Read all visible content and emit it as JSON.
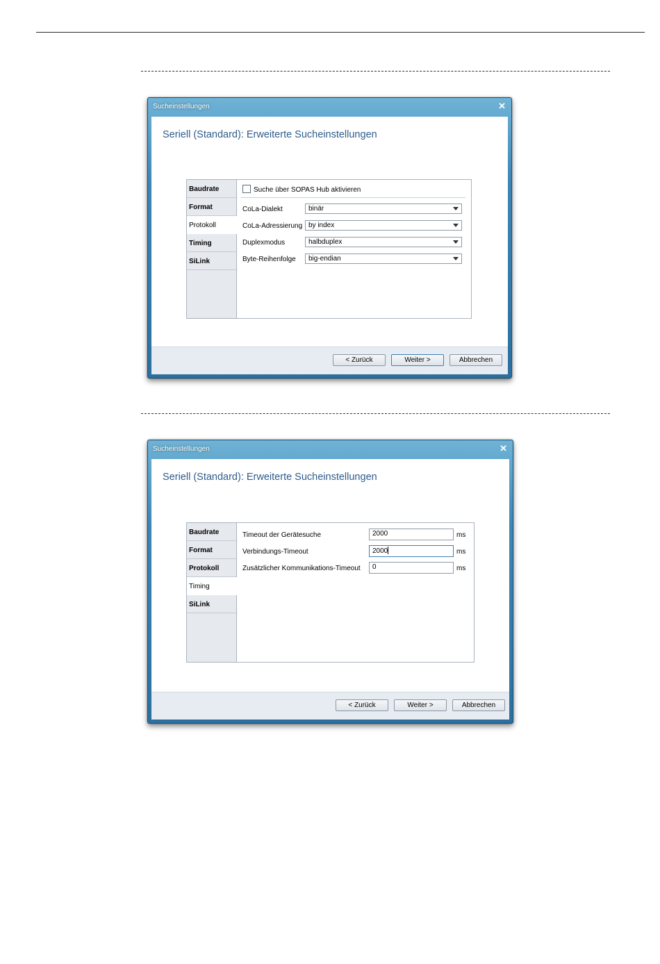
{
  "dialog1": {
    "title": "Sucheinstellungen",
    "heading": "Seriell (Standard): Erweiterte Sucheinstellungen",
    "tabs": [
      "Baudrate",
      "Format",
      "Protokoll",
      "Timing",
      "SiLink"
    ],
    "active_tab": "Protokoll",
    "checkbox_label": "Suche über SOPAS Hub aktivieren",
    "checkbox_checked": false,
    "fields": [
      {
        "label": "CoLa-Dialekt",
        "value": "binär"
      },
      {
        "label": "CoLa-Adressierung",
        "value": "by index"
      },
      {
        "label": "Duplexmodus",
        "value": "halbduplex"
      },
      {
        "label": "Byte-Reihenfolge",
        "value": "big-endian"
      }
    ],
    "buttons": {
      "back": "< Zurück",
      "next": "Weiter >",
      "cancel": "Abbrechen"
    }
  },
  "dialog2": {
    "title": "Sucheinstellungen",
    "heading": "Seriell (Standard): Erweiterte Sucheinstellungen",
    "tabs": [
      "Baudrate",
      "Format",
      "Protokoll",
      "Timing",
      "SiLink"
    ],
    "active_tab": "Timing",
    "fields": [
      {
        "label": "Timeout der Gerätesuche",
        "value": "2000",
        "unit": "ms"
      },
      {
        "label": "Verbindungs-Timeout",
        "value": "2000",
        "unit": "ms"
      },
      {
        "label": "Zusätzlicher Kommunikations-Timeout",
        "value": "0",
        "unit": "ms"
      }
    ],
    "buttons": {
      "back": "< Zurück",
      "next": "Weiter >",
      "cancel": "Abbrechen"
    }
  }
}
